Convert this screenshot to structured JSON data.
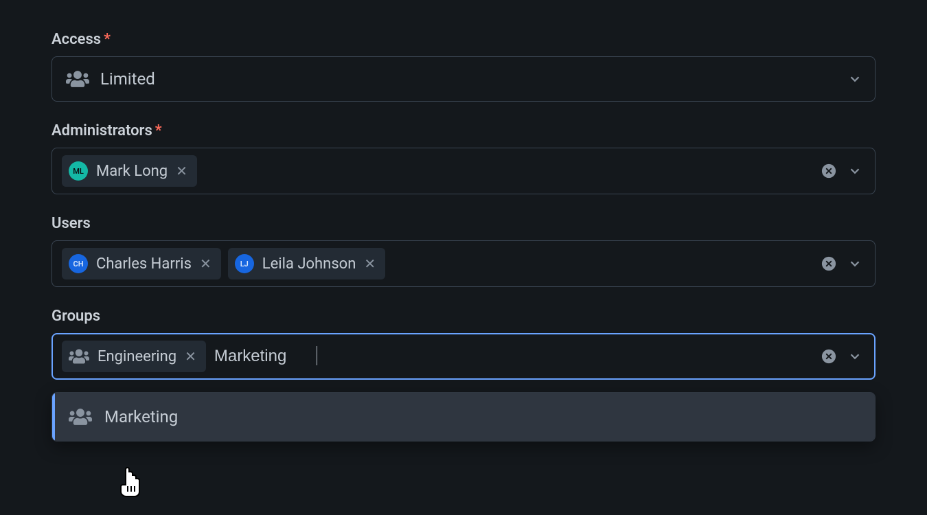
{
  "access": {
    "label": "Access",
    "required": true,
    "value": "Limited"
  },
  "administrators": {
    "label": "Administrators",
    "required": true,
    "chips": [
      {
        "name": "Mark Long",
        "initials": "ML",
        "color": "teal"
      }
    ]
  },
  "users": {
    "label": "Users",
    "required": false,
    "chips": [
      {
        "name": "Charles Harris",
        "initials": "CH",
        "color": "blue"
      },
      {
        "name": "Leila Johnson",
        "initials": "LJ",
        "color": "blue"
      }
    ]
  },
  "groups": {
    "label": "Groups",
    "required": false,
    "chips": [
      {
        "name": "Engineering"
      }
    ],
    "search": "Marketing",
    "options": [
      {
        "name": "Marketing",
        "highlighted": true
      }
    ]
  }
}
